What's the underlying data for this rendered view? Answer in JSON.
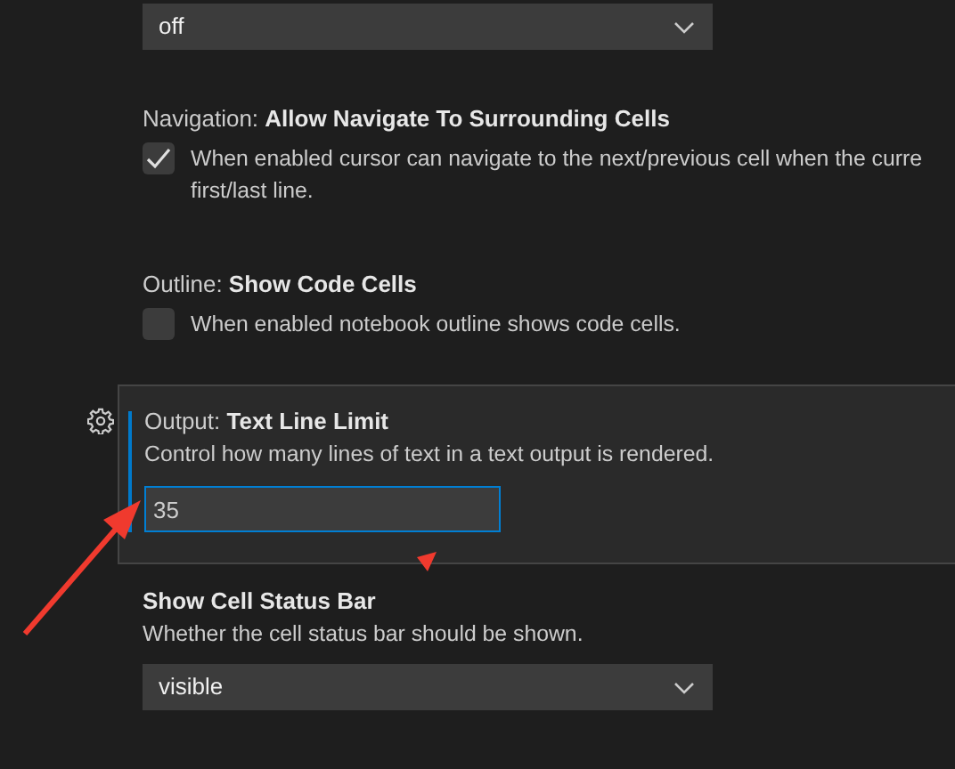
{
  "settings": [
    {
      "kind": "dropdown",
      "value": "off",
      "focused": false
    },
    {
      "kind": "checkbox",
      "category": "Navigation: ",
      "name": "Allow Navigate To Surrounding Cells",
      "checked": true,
      "description_lines": [
        "When enabled cursor can navigate to the next/previous cell when the curre",
        "first/last line."
      ],
      "focused": false
    },
    {
      "kind": "checkbox",
      "category": "Outline: ",
      "name": "Show Code Cells",
      "checked": false,
      "description_lines": [
        "When enabled notebook outline shows code cells."
      ],
      "focused": false
    },
    {
      "kind": "number",
      "category": "Output: ",
      "name": "Text Line Limit",
      "description_lines": [
        "Control how many lines of text in a text output is rendered."
      ],
      "value": "35",
      "focused": true
    },
    {
      "kind": "dropdown",
      "name": "Show Cell Status Bar",
      "description_lines": [
        "Whether the cell status bar should be shown."
      ],
      "value": "visible",
      "focused": false
    }
  ]
}
